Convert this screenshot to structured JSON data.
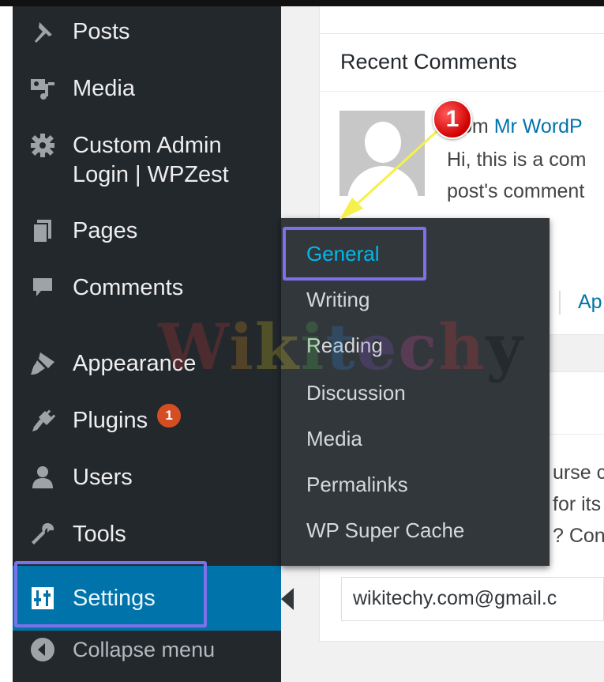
{
  "sidebar": {
    "items": [
      {
        "label": "Posts",
        "icon": "pushpin-icon"
      },
      {
        "label": "Media",
        "icon": "media-icon"
      },
      {
        "label": "Custom Admin",
        "label2": "Login | WPZest",
        "icon": "gear-icon"
      },
      {
        "label": "Pages",
        "icon": "pages-icon"
      },
      {
        "label": "Comments",
        "icon": "comment-icon"
      },
      {
        "label": "Appearance",
        "icon": "paintbrush-icon"
      },
      {
        "label": "Plugins",
        "icon": "plug-icon",
        "badge": "1"
      },
      {
        "label": "Users",
        "icon": "user-icon"
      },
      {
        "label": "Tools",
        "icon": "wrench-icon"
      },
      {
        "label": "Settings",
        "icon": "sliders-icon"
      },
      {
        "label": "Collapse menu",
        "icon": "collapse-arrow-icon"
      }
    ]
  },
  "submenu": {
    "items": [
      "General",
      "Writing",
      "Reading",
      "Discussion",
      "Media",
      "Permalinks",
      "WP Super Cache"
    ]
  },
  "dashboard": {
    "recent_comments_title": "Recent Comments",
    "comment_from": "om",
    "comment_author": "Mr WordP",
    "comment_line2": "Hi, this is a com",
    "comment_line3": "post's comment",
    "action_link": "Ap",
    "quick_line1": "urse c",
    "quick_line2": "for its",
    "quick_line3": "? Con",
    "email_value": "wikitechy.com@gmail.c"
  },
  "annotation": {
    "step_number": "1"
  },
  "watermark_text": [
    "W",
    "i",
    "k",
    "i",
    "t",
    "e",
    "c",
    "h",
    "y"
  ],
  "colors": {
    "sidebar_bg": "#23282d",
    "submenu_bg": "#32373c",
    "active_blue": "#0073aa",
    "submenu_active": "#00b9eb",
    "highlight": "#7b72e9",
    "badge": "#d54e21"
  }
}
